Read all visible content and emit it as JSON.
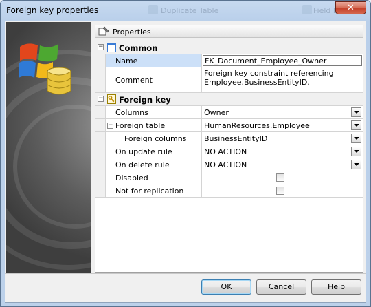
{
  "window": {
    "title": "Foreign key properties",
    "close_glyph": "✕",
    "background_ghost": [
      "Duplicate Table",
      "Field Ed"
    ]
  },
  "panel": {
    "header": "Properties"
  },
  "categories": [
    {
      "label": "Common",
      "icon": "document-icon"
    },
    {
      "label": "Foreign key",
      "icon": "key-icon"
    }
  ],
  "rows": {
    "name": {
      "label": "Name",
      "value": "FK_Document_Employee_Owner"
    },
    "comment": {
      "label": "Comment",
      "value_line1": "Foreign key constraint referencing",
      "value_line2": "Employee.BusinessEntityID."
    },
    "columns": {
      "label": "Columns",
      "value": "Owner"
    },
    "foreign_table": {
      "label": "Foreign table",
      "value": "HumanResources.Employee"
    },
    "foreign_columns": {
      "label": "Foreign columns",
      "value": "BusinessEntityID"
    },
    "on_update": {
      "label": "On update rule",
      "value": "NO ACTION"
    },
    "on_delete": {
      "label": "On delete rule",
      "value": "NO ACTION"
    },
    "disabled": {
      "label": "Disabled",
      "checked": false
    },
    "not_for_replication": {
      "label": "Not for replication",
      "checked": false
    }
  },
  "buttons": {
    "ok_prefix": "",
    "ok_mnemonic": "O",
    "ok_rest": "K",
    "cancel": "Cancel",
    "help_mnemonic": "H",
    "help_rest": "elp"
  },
  "colors": {
    "selection": "#cce0f8",
    "window_frame": "#b9cfea",
    "close_button": "#c5422b"
  }
}
